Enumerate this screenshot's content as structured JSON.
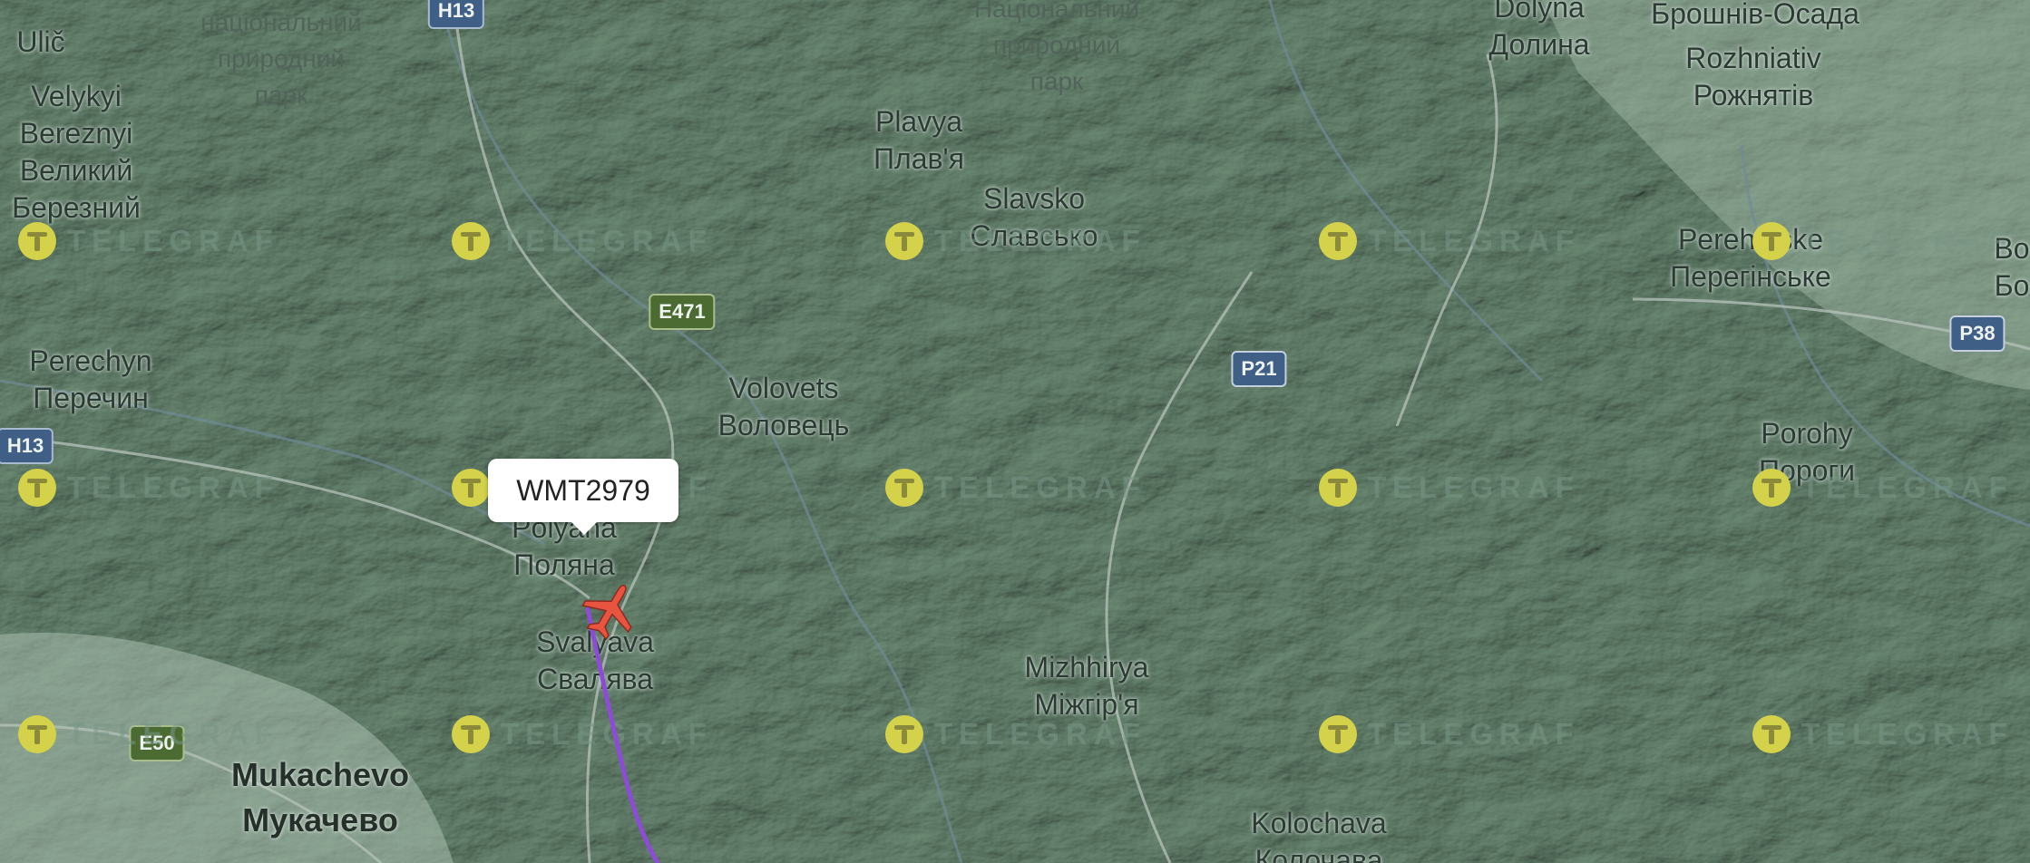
{
  "map": {
    "watermark_text": "TELEGRAF",
    "watermark_color": "#d4d24a",
    "terrain_color": "#7f9a88",
    "flight_track_color": "#8d4bd6",
    "aircraft_color": "#e8543f"
  },
  "parks": [
    {
      "name": "park-label-left",
      "lines": [
        "національний",
        "природний",
        "парк"
      ]
    },
    {
      "name": "park-label-center",
      "lines": [
        "Національний",
        "природний",
        "парк"
      ]
    }
  ],
  "places": [
    {
      "name": "place-ulic",
      "lines": [
        "Ulič"
      ]
    },
    {
      "name": "place-velykyi-bereznyi",
      "lines": [
        "Velykyi",
        "Bereznyi",
        "Великий",
        "Березний"
      ]
    },
    {
      "name": "place-perechyn",
      "lines": [
        "Perechyn",
        "Перечин"
      ]
    },
    {
      "name": "place-plavya",
      "lines": [
        "Plavya",
        "Плав'я"
      ]
    },
    {
      "name": "place-slavsko",
      "lines": [
        "Slavsko",
        "Славсько"
      ]
    },
    {
      "name": "place-dolyna",
      "lines": [
        "Dolyna",
        "Долина"
      ]
    },
    {
      "name": "place-broshniv",
      "lines": [
        "Брошнів-Осада"
      ]
    },
    {
      "name": "place-rozhniativ",
      "lines": [
        "Rozhniativ",
        "Рожнятів"
      ]
    },
    {
      "name": "place-perehinske",
      "lines": [
        "Perehinske",
        "Перегінське"
      ]
    },
    {
      "name": "place-bo",
      "lines": [
        "Bo",
        "Бо"
      ]
    },
    {
      "name": "place-porohy",
      "lines": [
        "Porohy",
        "Пороги"
      ]
    },
    {
      "name": "place-volovets",
      "lines": [
        "Volovets",
        "Воловець"
      ]
    },
    {
      "name": "place-polyana",
      "lines": [
        "Polyana",
        "Поляна"
      ]
    },
    {
      "name": "place-svalyava",
      "lines": [
        "Svalyava",
        "Свалява"
      ]
    },
    {
      "name": "place-mizhhirya",
      "lines": [
        "Mizhhirya",
        "Міжгір'я"
      ]
    },
    {
      "name": "place-kolochava",
      "lines": [
        "Kolochava",
        "Колочава"
      ]
    },
    {
      "name": "place-mukachevo",
      "lines": [
        "Mukachevo",
        "Мукачево"
      ]
    }
  ],
  "roads": [
    {
      "name": "road-shield-h13-top",
      "label": "H13"
    },
    {
      "name": "road-shield-h13-left",
      "label": "H13"
    },
    {
      "name": "road-shield-e471",
      "label": "E471"
    },
    {
      "name": "road-shield-p21",
      "label": "P21"
    },
    {
      "name": "road-shield-p38",
      "label": "P38"
    },
    {
      "name": "road-shield-e50",
      "label": "E50"
    }
  ],
  "flight": {
    "callsign": "WMT2979"
  }
}
